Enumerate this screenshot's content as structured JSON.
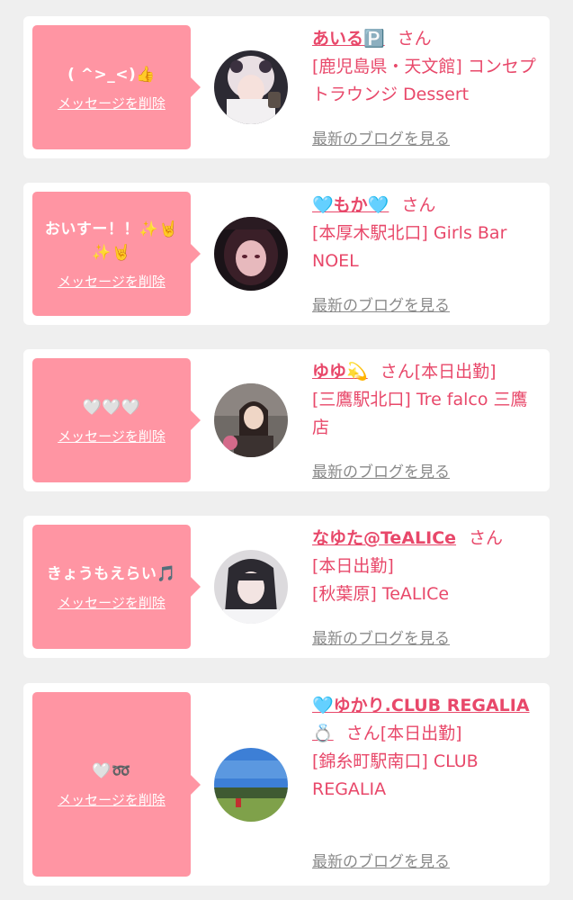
{
  "messages": [
    {
      "bubble_text": "( ^>_<)👍",
      "delete_label": "メッセージを削除",
      "name": "あいる🅿️",
      "san": "さん",
      "shop": "[鹿児島県・天文館] コンセプトラウンジ Dessert",
      "blog_link": "最新のブログを見る"
    },
    {
      "bubble_text": "おいすー！！✨🤘✨🤘",
      "delete_label": "メッセージを削除",
      "name": "🩵もか🩵",
      "san": "さん",
      "shop": "[本厚木駅北口] Girls Bar NOEL",
      "blog_link": "最新のブログを見る"
    },
    {
      "bubble_text": "🤍🤍🤍",
      "delete_label": "メッセージを削除",
      "name": "ゆゆ💫",
      "san": "さん",
      "status": "[本日出勤]",
      "shop": "[三鷹駅北口] Tre falco 三鷹店",
      "blog_link": "最新のブログを見る"
    },
    {
      "bubble_text": "きょうもえらい🎵",
      "delete_label": "メッセージを削除",
      "name": "なゆた@TeALICe",
      "san": "さん",
      "status": "[本日出勤]",
      "shop": "[秋葉原] TeALICe",
      "blog_link": "最新のブログを見る"
    },
    {
      "bubble_text": "🤍➿",
      "delete_label": "メッセージを削除",
      "name": "🩵ゆかり.CLUB REGALIA💍",
      "san": "さん",
      "status": "[本日出勤]",
      "shop": "[錦糸町駅南口] CLUB REGALIA",
      "blog_link": "最新のブログを見る"
    }
  ]
}
